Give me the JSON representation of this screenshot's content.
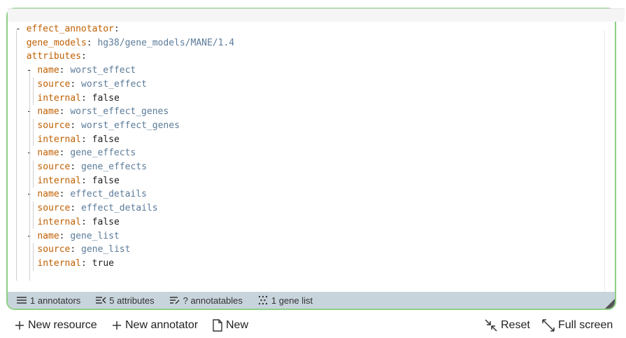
{
  "editor": {
    "lines": [
      {
        "indent": 0,
        "dash": true,
        "key": "effect_annotator",
        "value": "",
        "vtype": "none"
      },
      {
        "indent": 1,
        "dash": false,
        "key": "gene_models",
        "value": "hg38/gene_models/MANE/1.4",
        "vtype": "str"
      },
      {
        "indent": 1,
        "dash": false,
        "key": "attributes",
        "value": "",
        "vtype": "none"
      },
      {
        "indent": 1,
        "dash": true,
        "key": "name",
        "value": "worst_effect",
        "vtype": "str"
      },
      {
        "indent": 2,
        "dash": false,
        "key": "source",
        "value": "worst_effect",
        "vtype": "str"
      },
      {
        "indent": 2,
        "dash": false,
        "key": "internal",
        "value": "false",
        "vtype": "bool"
      },
      {
        "indent": 1,
        "dash": true,
        "key": "name",
        "value": "worst_effect_genes",
        "vtype": "str"
      },
      {
        "indent": 2,
        "dash": false,
        "key": "source",
        "value": "worst_effect_genes",
        "vtype": "str"
      },
      {
        "indent": 2,
        "dash": false,
        "key": "internal",
        "value": "false",
        "vtype": "bool"
      },
      {
        "indent": 1,
        "dash": true,
        "key": "name",
        "value": "gene_effects",
        "vtype": "str"
      },
      {
        "indent": 2,
        "dash": false,
        "key": "source",
        "value": "gene_effects",
        "vtype": "str"
      },
      {
        "indent": 2,
        "dash": false,
        "key": "internal",
        "value": "false",
        "vtype": "bool"
      },
      {
        "indent": 1,
        "dash": true,
        "key": "name",
        "value": "effect_details",
        "vtype": "str"
      },
      {
        "indent": 2,
        "dash": false,
        "key": "source",
        "value": "effect_details",
        "vtype": "str"
      },
      {
        "indent": 2,
        "dash": false,
        "key": "internal",
        "value": "false",
        "vtype": "bool"
      },
      {
        "indent": 1,
        "dash": true,
        "key": "name",
        "value": "gene_list",
        "vtype": "str"
      },
      {
        "indent": 2,
        "dash": false,
        "key": "source",
        "value": "gene_list",
        "vtype": "str"
      },
      {
        "indent": 2,
        "dash": false,
        "key": "internal",
        "value": "true",
        "vtype": "bool"
      }
    ]
  },
  "status": {
    "annotators": "1 annotators",
    "attributes": "5 attributes",
    "annotatables": "? annotatables",
    "gene_list": "1 gene list"
  },
  "toolbar": {
    "new_resource": "New resource",
    "new_annotator": "New annotator",
    "new": "New",
    "reset": "Reset",
    "full_screen": "Full screen"
  },
  "colors": {
    "frame_border": "#8ccf84",
    "status_bg": "#c8d4dc",
    "key": "#c05f00",
    "string": "#5b7b9a"
  }
}
